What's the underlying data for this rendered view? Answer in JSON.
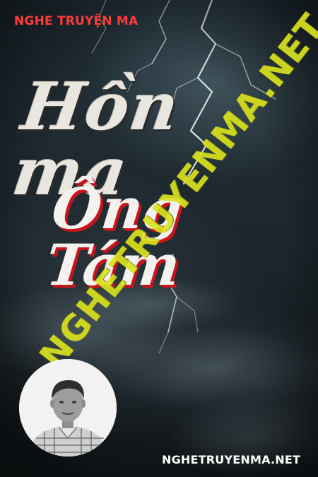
{
  "brand": {
    "top_label": "NGHE TRUYỆN MA",
    "bottom_label": "NGHETRUYENMA.NET"
  },
  "title": {
    "line1": "Hồn ma",
    "line2": "Ông Tám"
  },
  "watermark": {
    "text": "NGHETRUYENMA.NET",
    "color": "#d9e21e"
  },
  "colors": {
    "accent_red": "#ff3b3b",
    "title_shadow_red": "#c8151d",
    "background": "#1d272d"
  }
}
